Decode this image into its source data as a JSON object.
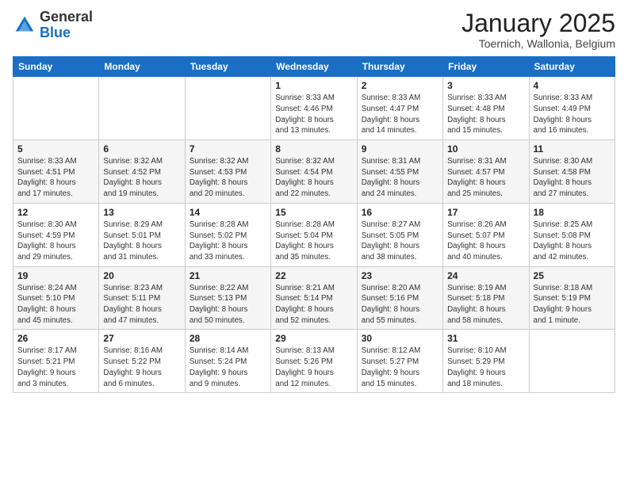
{
  "logo": {
    "general": "General",
    "blue": "Blue"
  },
  "title": "January 2025",
  "location": "Toernich, Wallonia, Belgium",
  "days_of_week": [
    "Sunday",
    "Monday",
    "Tuesday",
    "Wednesday",
    "Thursday",
    "Friday",
    "Saturday"
  ],
  "weeks": [
    [
      {
        "num": "",
        "info": ""
      },
      {
        "num": "",
        "info": ""
      },
      {
        "num": "",
        "info": ""
      },
      {
        "num": "1",
        "info": "Sunrise: 8:33 AM\nSunset: 4:46 PM\nDaylight: 8 hours\nand 13 minutes."
      },
      {
        "num": "2",
        "info": "Sunrise: 8:33 AM\nSunset: 4:47 PM\nDaylight: 8 hours\nand 14 minutes."
      },
      {
        "num": "3",
        "info": "Sunrise: 8:33 AM\nSunset: 4:48 PM\nDaylight: 8 hours\nand 15 minutes."
      },
      {
        "num": "4",
        "info": "Sunrise: 8:33 AM\nSunset: 4:49 PM\nDaylight: 8 hours\nand 16 minutes."
      }
    ],
    [
      {
        "num": "5",
        "info": "Sunrise: 8:33 AM\nSunset: 4:51 PM\nDaylight: 8 hours\nand 17 minutes."
      },
      {
        "num": "6",
        "info": "Sunrise: 8:32 AM\nSunset: 4:52 PM\nDaylight: 8 hours\nand 19 minutes."
      },
      {
        "num": "7",
        "info": "Sunrise: 8:32 AM\nSunset: 4:53 PM\nDaylight: 8 hours\nand 20 minutes."
      },
      {
        "num": "8",
        "info": "Sunrise: 8:32 AM\nSunset: 4:54 PM\nDaylight: 8 hours\nand 22 minutes."
      },
      {
        "num": "9",
        "info": "Sunrise: 8:31 AM\nSunset: 4:55 PM\nDaylight: 8 hours\nand 24 minutes."
      },
      {
        "num": "10",
        "info": "Sunrise: 8:31 AM\nSunset: 4:57 PM\nDaylight: 8 hours\nand 25 minutes."
      },
      {
        "num": "11",
        "info": "Sunrise: 8:30 AM\nSunset: 4:58 PM\nDaylight: 8 hours\nand 27 minutes."
      }
    ],
    [
      {
        "num": "12",
        "info": "Sunrise: 8:30 AM\nSunset: 4:59 PM\nDaylight: 8 hours\nand 29 minutes."
      },
      {
        "num": "13",
        "info": "Sunrise: 8:29 AM\nSunset: 5:01 PM\nDaylight: 8 hours\nand 31 minutes."
      },
      {
        "num": "14",
        "info": "Sunrise: 8:28 AM\nSunset: 5:02 PM\nDaylight: 8 hours\nand 33 minutes."
      },
      {
        "num": "15",
        "info": "Sunrise: 8:28 AM\nSunset: 5:04 PM\nDaylight: 8 hours\nand 35 minutes."
      },
      {
        "num": "16",
        "info": "Sunrise: 8:27 AM\nSunset: 5:05 PM\nDaylight: 8 hours\nand 38 minutes."
      },
      {
        "num": "17",
        "info": "Sunrise: 8:26 AM\nSunset: 5:07 PM\nDaylight: 8 hours\nand 40 minutes."
      },
      {
        "num": "18",
        "info": "Sunrise: 8:25 AM\nSunset: 5:08 PM\nDaylight: 8 hours\nand 42 minutes."
      }
    ],
    [
      {
        "num": "19",
        "info": "Sunrise: 8:24 AM\nSunset: 5:10 PM\nDaylight: 8 hours\nand 45 minutes."
      },
      {
        "num": "20",
        "info": "Sunrise: 8:23 AM\nSunset: 5:11 PM\nDaylight: 8 hours\nand 47 minutes."
      },
      {
        "num": "21",
        "info": "Sunrise: 8:22 AM\nSunset: 5:13 PM\nDaylight: 8 hours\nand 50 minutes."
      },
      {
        "num": "22",
        "info": "Sunrise: 8:21 AM\nSunset: 5:14 PM\nDaylight: 8 hours\nand 52 minutes."
      },
      {
        "num": "23",
        "info": "Sunrise: 8:20 AM\nSunset: 5:16 PM\nDaylight: 8 hours\nand 55 minutes."
      },
      {
        "num": "24",
        "info": "Sunrise: 8:19 AM\nSunset: 5:18 PM\nDaylight: 8 hours\nand 58 minutes."
      },
      {
        "num": "25",
        "info": "Sunrise: 8:18 AM\nSunset: 5:19 PM\nDaylight: 9 hours\nand 1 minute."
      }
    ],
    [
      {
        "num": "26",
        "info": "Sunrise: 8:17 AM\nSunset: 5:21 PM\nDaylight: 9 hours\nand 3 minutes."
      },
      {
        "num": "27",
        "info": "Sunrise: 8:16 AM\nSunset: 5:22 PM\nDaylight: 9 hours\nand 6 minutes."
      },
      {
        "num": "28",
        "info": "Sunrise: 8:14 AM\nSunset: 5:24 PM\nDaylight: 9 hours\nand 9 minutes."
      },
      {
        "num": "29",
        "info": "Sunrise: 8:13 AM\nSunset: 5:26 PM\nDaylight: 9 hours\nand 12 minutes."
      },
      {
        "num": "30",
        "info": "Sunrise: 8:12 AM\nSunset: 5:27 PM\nDaylight: 9 hours\nand 15 minutes."
      },
      {
        "num": "31",
        "info": "Sunrise: 8:10 AM\nSunset: 5:29 PM\nDaylight: 9 hours\nand 18 minutes."
      },
      {
        "num": "",
        "info": ""
      }
    ]
  ]
}
